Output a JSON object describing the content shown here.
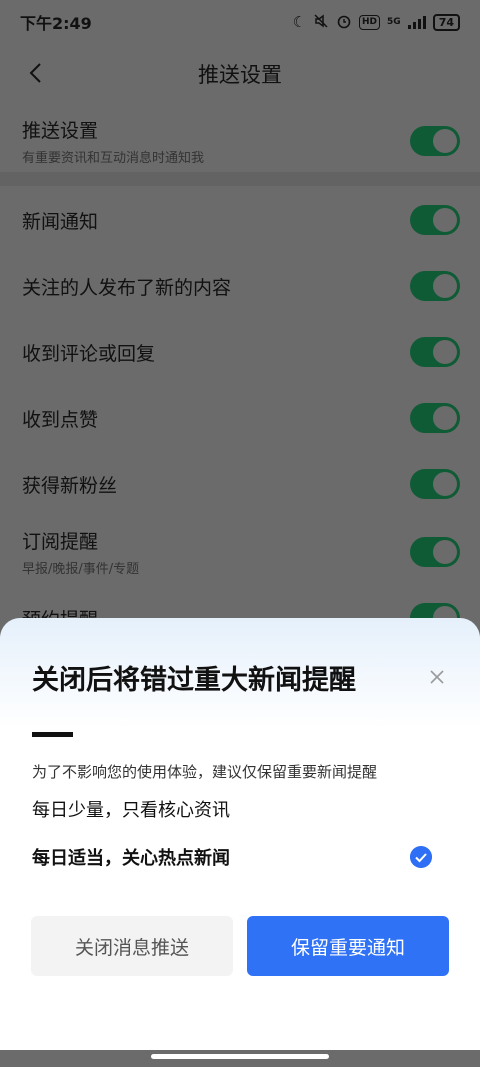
{
  "status_bar": {
    "time": "下午2:49",
    "network": "5G",
    "hd": "HD",
    "battery": "74"
  },
  "nav": {
    "title": "推送设置"
  },
  "settings": {
    "push": {
      "label": "推送设置",
      "sub": "有重要资讯和互动消息时通知我",
      "on": true
    },
    "items": [
      {
        "label": "新闻通知",
        "on": true
      },
      {
        "label": "关注的人发布了新的内容",
        "on": true
      },
      {
        "label": "收到评论或回复",
        "on": true
      },
      {
        "label": "收到点赞",
        "on": true
      },
      {
        "label": "获得新粉丝",
        "on": true
      },
      {
        "label": "订阅提醒",
        "sub": "早报/晚报/事件/专题",
        "on": true
      },
      {
        "label": "预约提醒",
        "on": true
      }
    ]
  },
  "sheet": {
    "title": "关闭后将错过重大新闻提醒",
    "desc": "为了不影响您的使用体验，建议仅保留重要新闻提醒",
    "option_1": "每日少量，只看核心资讯",
    "option_2": "每日适当，关心热点新闻",
    "option_2_selected": true,
    "btn_close": "关闭消息推送",
    "btn_keep": "保留重要通知"
  },
  "colors": {
    "accent": "#2f72f5",
    "toggle": "#0f5b35",
    "overlay": "#6b6b6b"
  }
}
